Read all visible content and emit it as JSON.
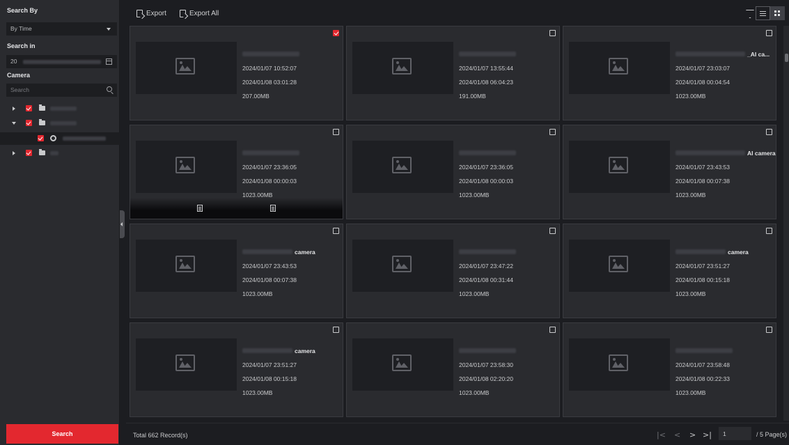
{
  "sidebar": {
    "search_by_label": "Search By",
    "search_by_value": "By Time",
    "search_in_label": "Search in",
    "search_in_value": "20",
    "camera_label": "Camera",
    "camera_search_placeholder": "Search",
    "search_button": "Search"
  },
  "toolbar": {
    "export_label": "Export",
    "export_all_label": "Export All"
  },
  "cards": [
    {
      "name_suffix": "",
      "start": "2024/01/07 10:52:07",
      "end": "2024/01/08 03:01:28",
      "size": "207.00MB",
      "checked": true
    },
    {
      "name_suffix": "",
      "start": "2024/01/07 13:55:44",
      "end": "2024/01/08 06:04:23",
      "size": "191.00MB",
      "checked": false
    },
    {
      "name_suffix": "_AI ca...",
      "start": "2024/01/07 23:03:07",
      "end": "2024/01/08 00:04:54",
      "size": "1023.00MB",
      "checked": false
    },
    {
      "name_suffix": "",
      "start": "2024/01/07 23:36:05",
      "end": "2024/01/08 00:00:03",
      "size": "1023.00MB",
      "checked": false
    },
    {
      "name_suffix": "",
      "start": "2024/01/07 23:36:05",
      "end": "2024/01/08 00:00:03",
      "size": "1023.00MB",
      "checked": false
    },
    {
      "name_suffix": "AI camera",
      "start": "2024/01/07 23:43:53",
      "end": "2024/01/08 00:07:38",
      "size": "1023.00MB",
      "checked": false
    },
    {
      "name_suffix": "camera",
      "start": "2024/01/07 23:43:53",
      "end": "2024/01/08 00:07:38",
      "size": "1023.00MB",
      "checked": false
    },
    {
      "name_suffix": "",
      "start": "2024/01/07 23:47:22",
      "end": "2024/01/08 00:31:44",
      "size": "1023.00MB",
      "checked": false
    },
    {
      "name_suffix": "camera",
      "start": "2024/01/07 23:51:27",
      "end": "2024/01/08 00:15:18",
      "size": "1023.00MB",
      "checked": false
    },
    {
      "name_suffix": "camera",
      "start": "2024/01/07 23:51:27",
      "end": "2024/01/08 00:15:18",
      "size": "1023.00MB",
      "checked": false
    },
    {
      "name_suffix": "",
      "start": "2024/01/07 23:58:30",
      "end": "2024/01/08 02:20:20",
      "size": "1023.00MB",
      "checked": false
    },
    {
      "name_suffix": "",
      "start": "2024/01/07 23:58:48",
      "end": "2024/01/08 00:22:33",
      "size": "1023.00MB",
      "checked": false
    }
  ],
  "footer": {
    "total": "Total 662 Record(s)",
    "page_value": "1",
    "page_total": "/ 5 Page(s)"
  },
  "colors": {
    "accent": "#e3282f",
    "background": "#1c1d21",
    "panel": "#2a2b2f"
  }
}
